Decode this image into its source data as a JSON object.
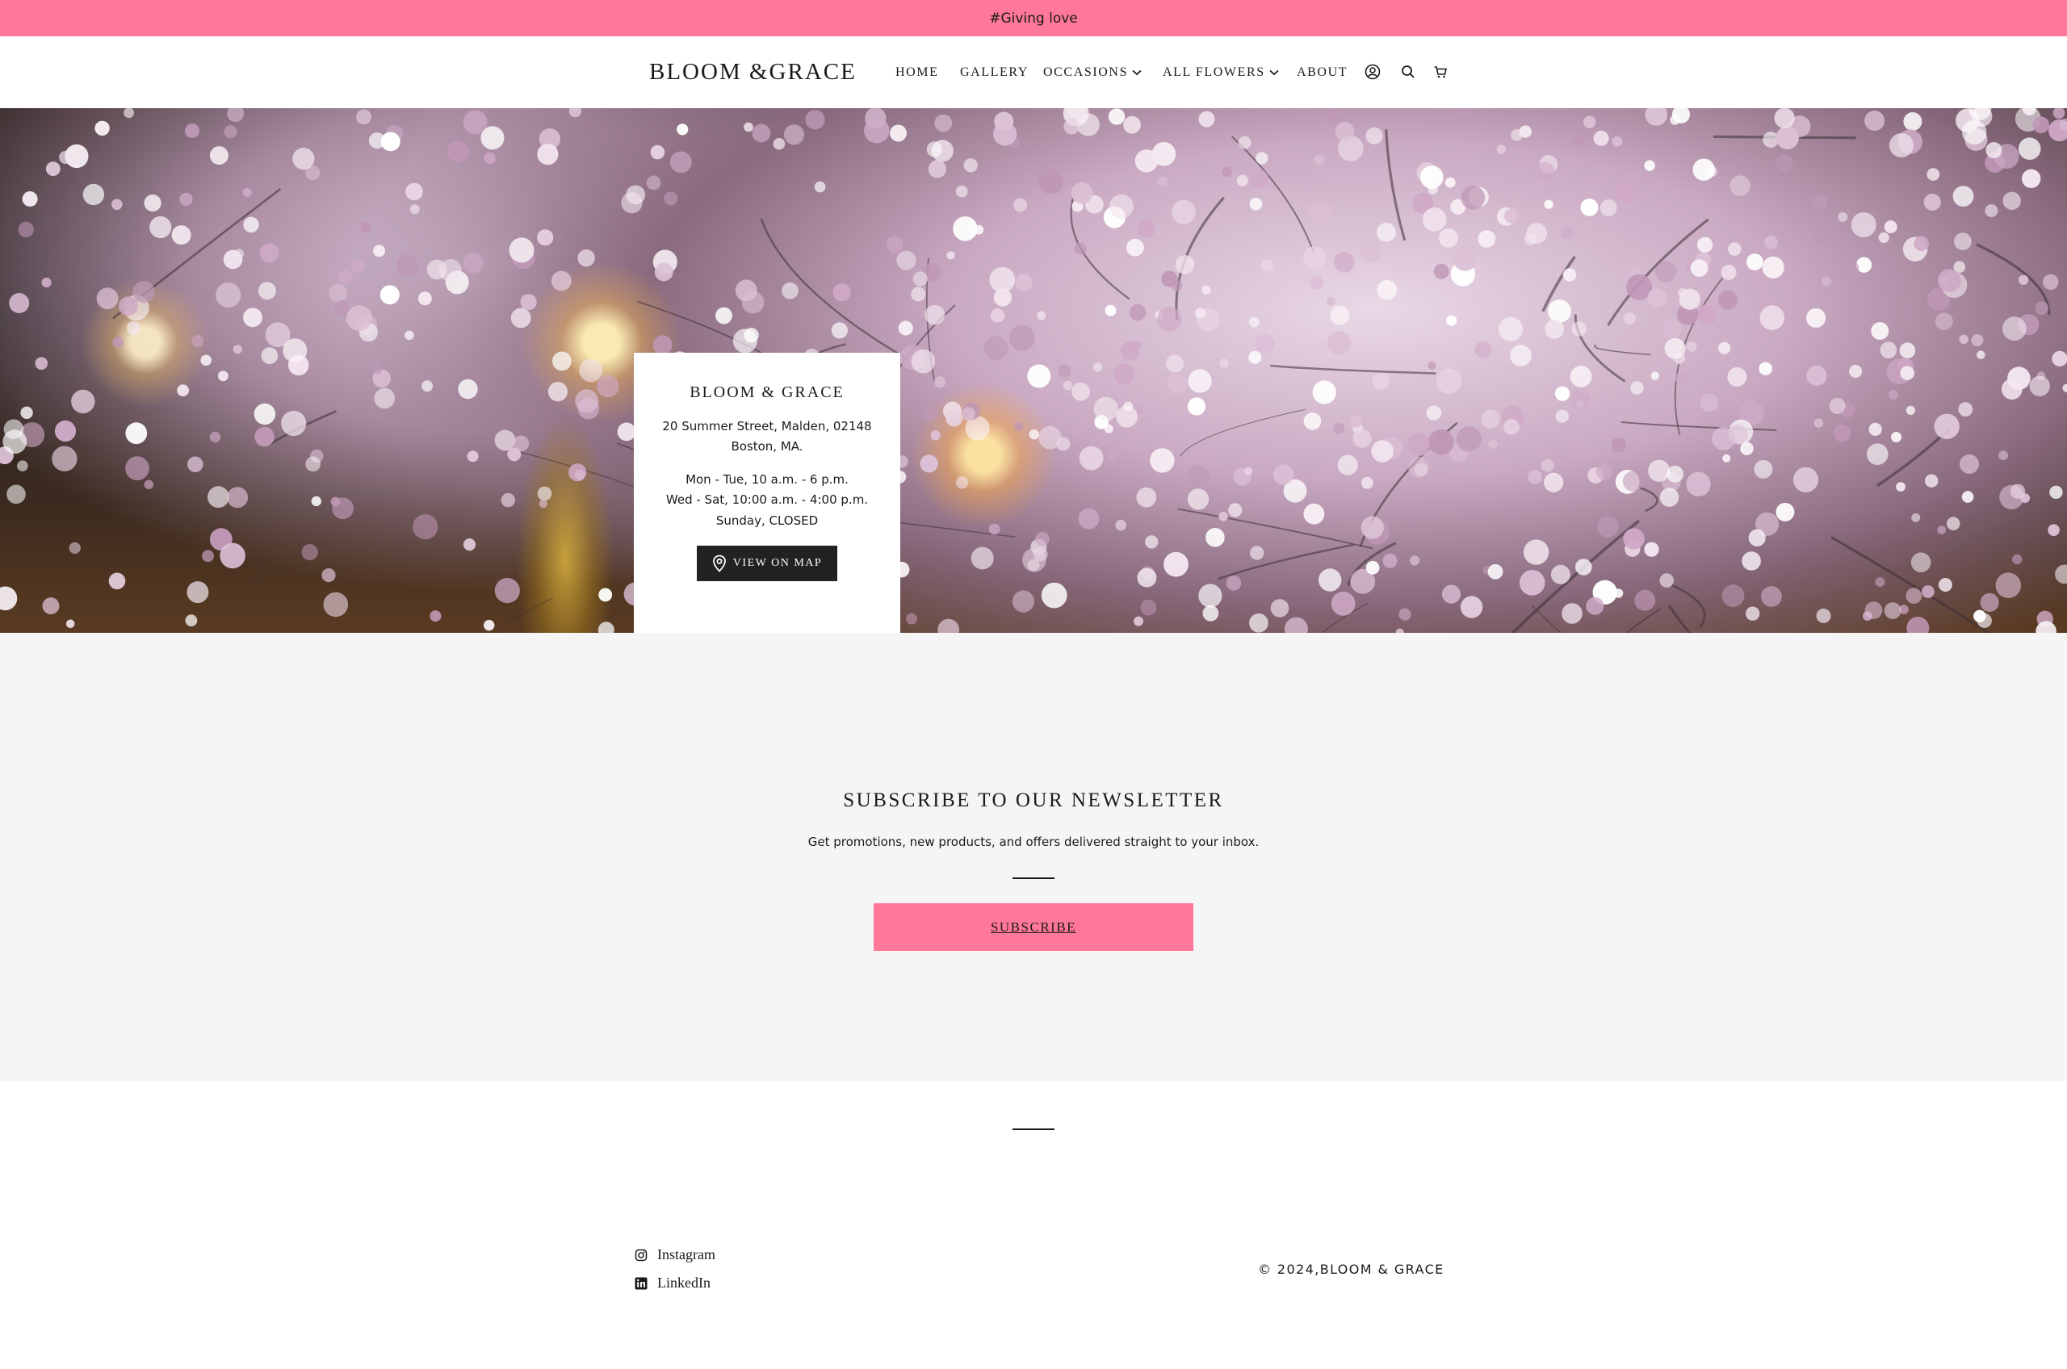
{
  "announcement": {
    "text": "#Giving love"
  },
  "header": {
    "logo": "BLOOM &GRACE",
    "nav": [
      {
        "label": "HOME",
        "dropdown": false
      },
      {
        "label": "GALLERY",
        "dropdown": false
      },
      {
        "label": "OCCASIONS",
        "dropdown": true
      },
      {
        "label": "ALL FLOWERS",
        "dropdown": true
      },
      {
        "label": "ABOUT",
        "dropdown": false
      }
    ],
    "icons": [
      "account-icon",
      "search-icon",
      "cart-icon"
    ]
  },
  "hero": {
    "card": {
      "title": "BLOOM & GRACE",
      "address_line1": "20 Summer Street, Malden, 02148",
      "address_line2": "Boston, MA.",
      "hours": [
        "Mon - Tue, 10 a.m. - 6 p.m.",
        "Wed - Sat, 10:00 a.m. - 4:00 p.m.",
        "Sunday, CLOSED"
      ],
      "map_button": "VIEW ON MAP"
    }
  },
  "newsletter": {
    "title": "SUBSCRIBE TO OUR NEWSLETTER",
    "subtitle": "Get promotions, new products, and offers delivered straight to your inbox.",
    "button": "SUBSCRIBE"
  },
  "footer": {
    "social": [
      {
        "label": "Instagram",
        "icon": "instagram-icon"
      },
      {
        "label": "LinkedIn",
        "icon": "linkedin-icon"
      }
    ],
    "copyright": "© 2024,BLOOM & GRACE"
  },
  "colors": {
    "accent_pink": "#ff7799",
    "newsletter_bg": "#f5f5f5",
    "button_dark": "#222222",
    "text": "#1a1a1a"
  }
}
